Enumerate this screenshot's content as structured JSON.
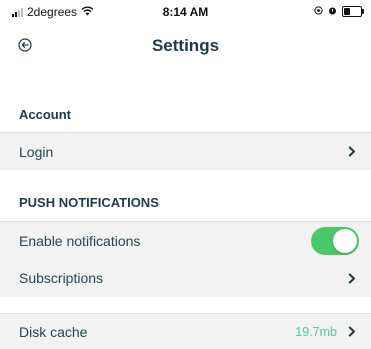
{
  "status_bar": {
    "carrier": "2degrees",
    "time": "8:14 AM",
    "battery_level": 0.35
  },
  "nav": {
    "title": "Settings",
    "back_icon": "back-circle-arrow-icon"
  },
  "sections": {
    "account": {
      "header": "Account",
      "login_label": "Login"
    },
    "push": {
      "header": "PUSH NOTIFICATIONS",
      "enable_label": "Enable notifications",
      "enable_on": true,
      "subscriptions_label": "Subscriptions"
    },
    "storage": {
      "disk_cache_label": "Disk cache",
      "disk_cache_value": "19.7mb"
    }
  },
  "colors": {
    "accent": "#52c7a2",
    "toggle_on": "#4cc86a",
    "text": "#1f3a46",
    "row_bg": "#f2f2f2"
  }
}
